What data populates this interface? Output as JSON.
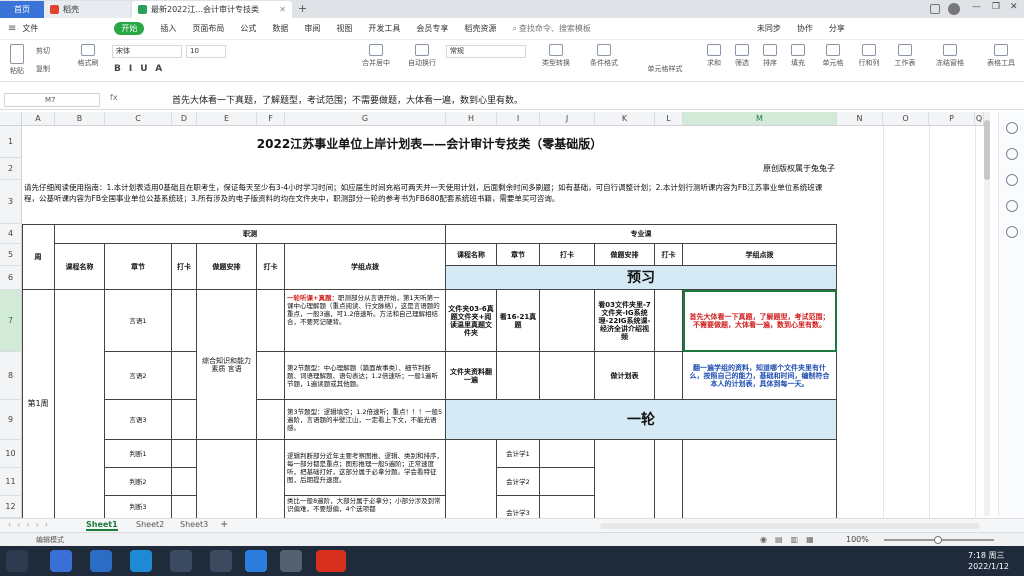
{
  "tabs": {
    "home": "首页",
    "t2": "稻壳",
    "t3": "最新2022江...会计审计专技类"
  },
  "window": {
    "new_tab": "+"
  },
  "menu": [
    "文件",
    "开始",
    "插入",
    "页面布局",
    "公式",
    "数据",
    "审阅",
    "视图",
    "开发工具",
    "会员专享",
    "稻壳资源"
  ],
  "menu_search": "查找命令、搜索模板",
  "menu_right": [
    "未同步",
    "协作",
    "分享"
  ],
  "ribbon": {
    "paste": "粘贴",
    "cut": "剪切",
    "copy": "复制",
    "format_painter": "格式刷",
    "font": "宋体",
    "size": "10",
    "merge": "合并居中",
    "wrap": "自动换行",
    "number_format": "常规",
    "type_convert": "类型转换",
    "cond_format": "条件格式",
    "cell_style": "单元格样式",
    "sum": "求和",
    "filter": "筛选",
    "sort": "排序",
    "fill": "填充",
    "cell": "单元格",
    "rowcol": "行和列",
    "worksheet": "工作表",
    "freeze": "冻结窗格",
    "table_tools": "表格工具"
  },
  "formula": {
    "name_box": "M7",
    "fx": "fx",
    "content": "首先大体看一下真题，了解题型，考试范围；不需要做题，大体看一遍，数到心里有数。"
  },
  "columns": [
    "A",
    "B",
    "C",
    "D",
    "E",
    "F",
    "G",
    "H",
    "I",
    "J",
    "K",
    "L",
    "M",
    "N",
    "O",
    "P",
    "Q"
  ],
  "rows": [
    "1",
    "2",
    "3",
    "4",
    "5",
    "6",
    "7",
    "8",
    "9",
    "10",
    "11",
    "12"
  ],
  "sheet": {
    "title": "2022江苏事业单位上岸计划表——会计审计专技类（零基础版）",
    "copyright": "原创版权属于兔兔子",
    "intro": "请先仔细阅读使用指南：1.本计划表适用0基础且在职考生，保证每天至少有3-4小时学习时间；如应届生时间充裕可两天并一天使用计划，后面剩余时间多刷题；如有基础，可自行调整计划；2.本计划行测听课内容为FB江苏事业单位系统班课程，公基听课内容为FB全国事业单位公基系统班；3.所有涉及的电子版资料的均在文件夹中，职测部分一轮的参考书为FB680配套系统班书籍，需要单买可咨询。",
    "hdr_week": "周",
    "hdr_zhice": "职测",
    "hdr_zhuanye": "专业课",
    "hdr_course": "课程名称",
    "hdr_chapter": "章节",
    "hdr_check": "打卡",
    "hdr_practice": "做题安排",
    "hdr_points": "学组点拨",
    "preview": "预习",
    "round1": "一轮",
    "week1": "第1周",
    "zc_course_e": "综合知识和能力素质 言语",
    "r7": {
      "c": "言语1",
      "g_red": "一轮听课+真题：",
      "g": "职测部分从言语开始，第1天听第一课中心理解题（重点阅读、行文脉络），这是言语题的重点，一般3遍，可1.2倍速听。方法和自己理解相结合，不要死记硬背。",
      "h": "文件夹03-6真题文件夹+阅读温里真题文件夹",
      "i": "看16-21真题",
      "k": "看03文件夹里-7文件夹-IG系统理-22IG系统课-经济全讲介绍视频",
      "m": "首先大体看一下真题，了解题型，考试范围；不需要做题，大体看一遍，数到心里有数。"
    },
    "r8": {
      "c": "言语2",
      "g": "第2节题型：中心理解题（篇面故事类）、细节判断题、词语理解题、语句表达；1.2倍速听；一般1遍听节题，1遍读题或其他题。",
      "h": "文件夹资料翻一遍",
      "k": "做计划表",
      "m": "翻一遍学组的资料，知道哪个文件夹里有什么，按照自己的能力，基础和时间，编制符合本人的计划表，具体到每一天。"
    },
    "r9": {
      "c": "言语3",
      "g": "第3节题型：逻辑填空；1.2倍速听；重点！！！一般5遍阶，言语题的半壁江山，一定看上下文，不能光语感。"
    },
    "r10": {
      "c": "判断1",
      "g": "逻辑判断部分近年主要考察图推、逻辑、类别和排序，每一部分都是重点；图形推理一般5遍阶；正常速度听，把基础打好，这部分属于必拿分题。学会看特征图，后期提升速度。",
      "i": "会计学1"
    },
    "r11": {
      "c": "判断2",
      "i": "会计学2"
    },
    "r12": {
      "c": "判断3",
      "g": "类比一般8遍阶，大部分属于必拿分；小部分涉及到常识偏难，不要想偏，4个选项都",
      "i": "会计学3"
    },
    "sheets": [
      "Sheet1",
      "Sheet2",
      "Sheet3"
    ],
    "sheet_add": "+"
  },
  "status": {
    "left": "编辑模式",
    "zoom": "100%",
    "time": "7:18 周三",
    "date": "2022/1/12"
  },
  "colors": {
    "accent_green": "#29a745",
    "header_blue": "#d6eaf5",
    "red_text": "#d01f1f",
    "blue_text": "#1f4fb0",
    "selection": "#1d7a3a"
  }
}
